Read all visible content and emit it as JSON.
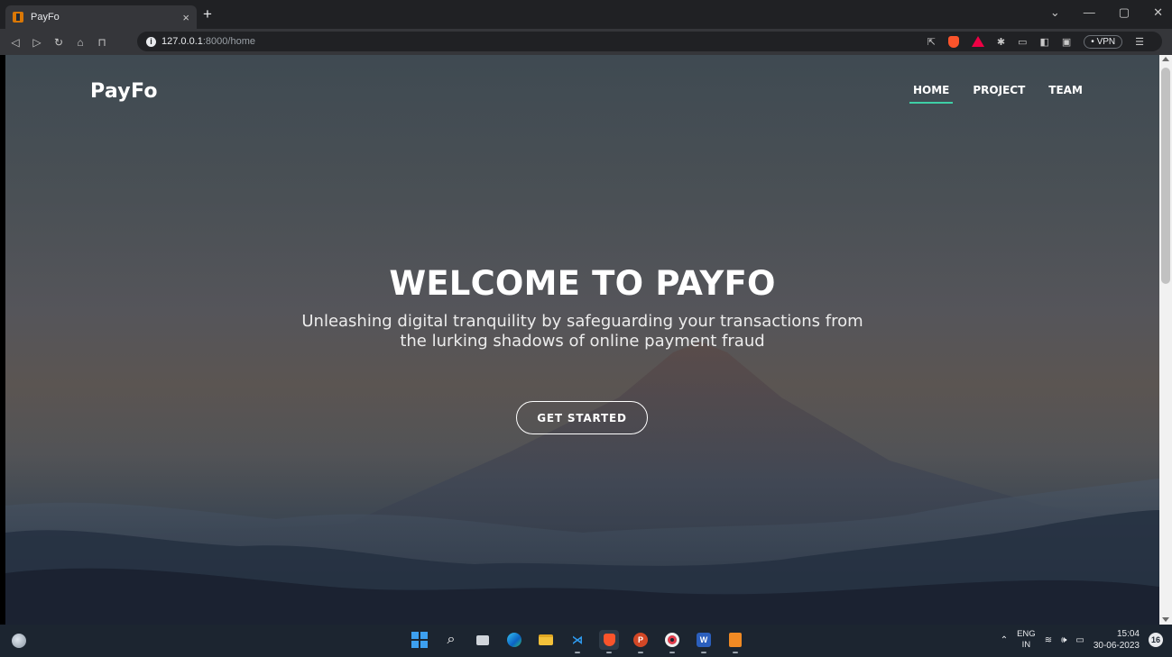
{
  "browser": {
    "tab_title": "PayFo",
    "tab_close": "×",
    "new_tab": "+",
    "address_host": "127.0.0.1",
    "address_path": ":8000/home",
    "vpn_label": "VPN",
    "window_controls": [
      "⌄",
      "—",
      "▢",
      "✕"
    ]
  },
  "site": {
    "brand": "PayFo",
    "nav": [
      {
        "label": "HOME",
        "active": true
      },
      {
        "label": "PROJECT",
        "active": false
      },
      {
        "label": "TEAM",
        "active": false
      }
    ],
    "hero": {
      "title": "WELCOME TO PAYFO",
      "subtitle_line1": "Unleashing digital tranquility by safeguarding your transactions from",
      "subtitle_line2": "the lurking shadows of online payment fraud",
      "cta_label": "GET STARTED"
    },
    "accent_color": "#3ecfa6"
  },
  "taskbar": {
    "lang_top": "ENG",
    "lang_bottom": "IN",
    "time": "15:04",
    "date": "30-06-2023",
    "notification_count": "16",
    "pinned_apps": [
      "start-icon",
      "search-icon",
      "task-view-icon",
      "edge-icon",
      "file-explorer-icon",
      "vscode-icon",
      "brave-icon",
      "powerpoint-icon",
      "opera-icon",
      "word-icon",
      "sublime-icon"
    ]
  }
}
